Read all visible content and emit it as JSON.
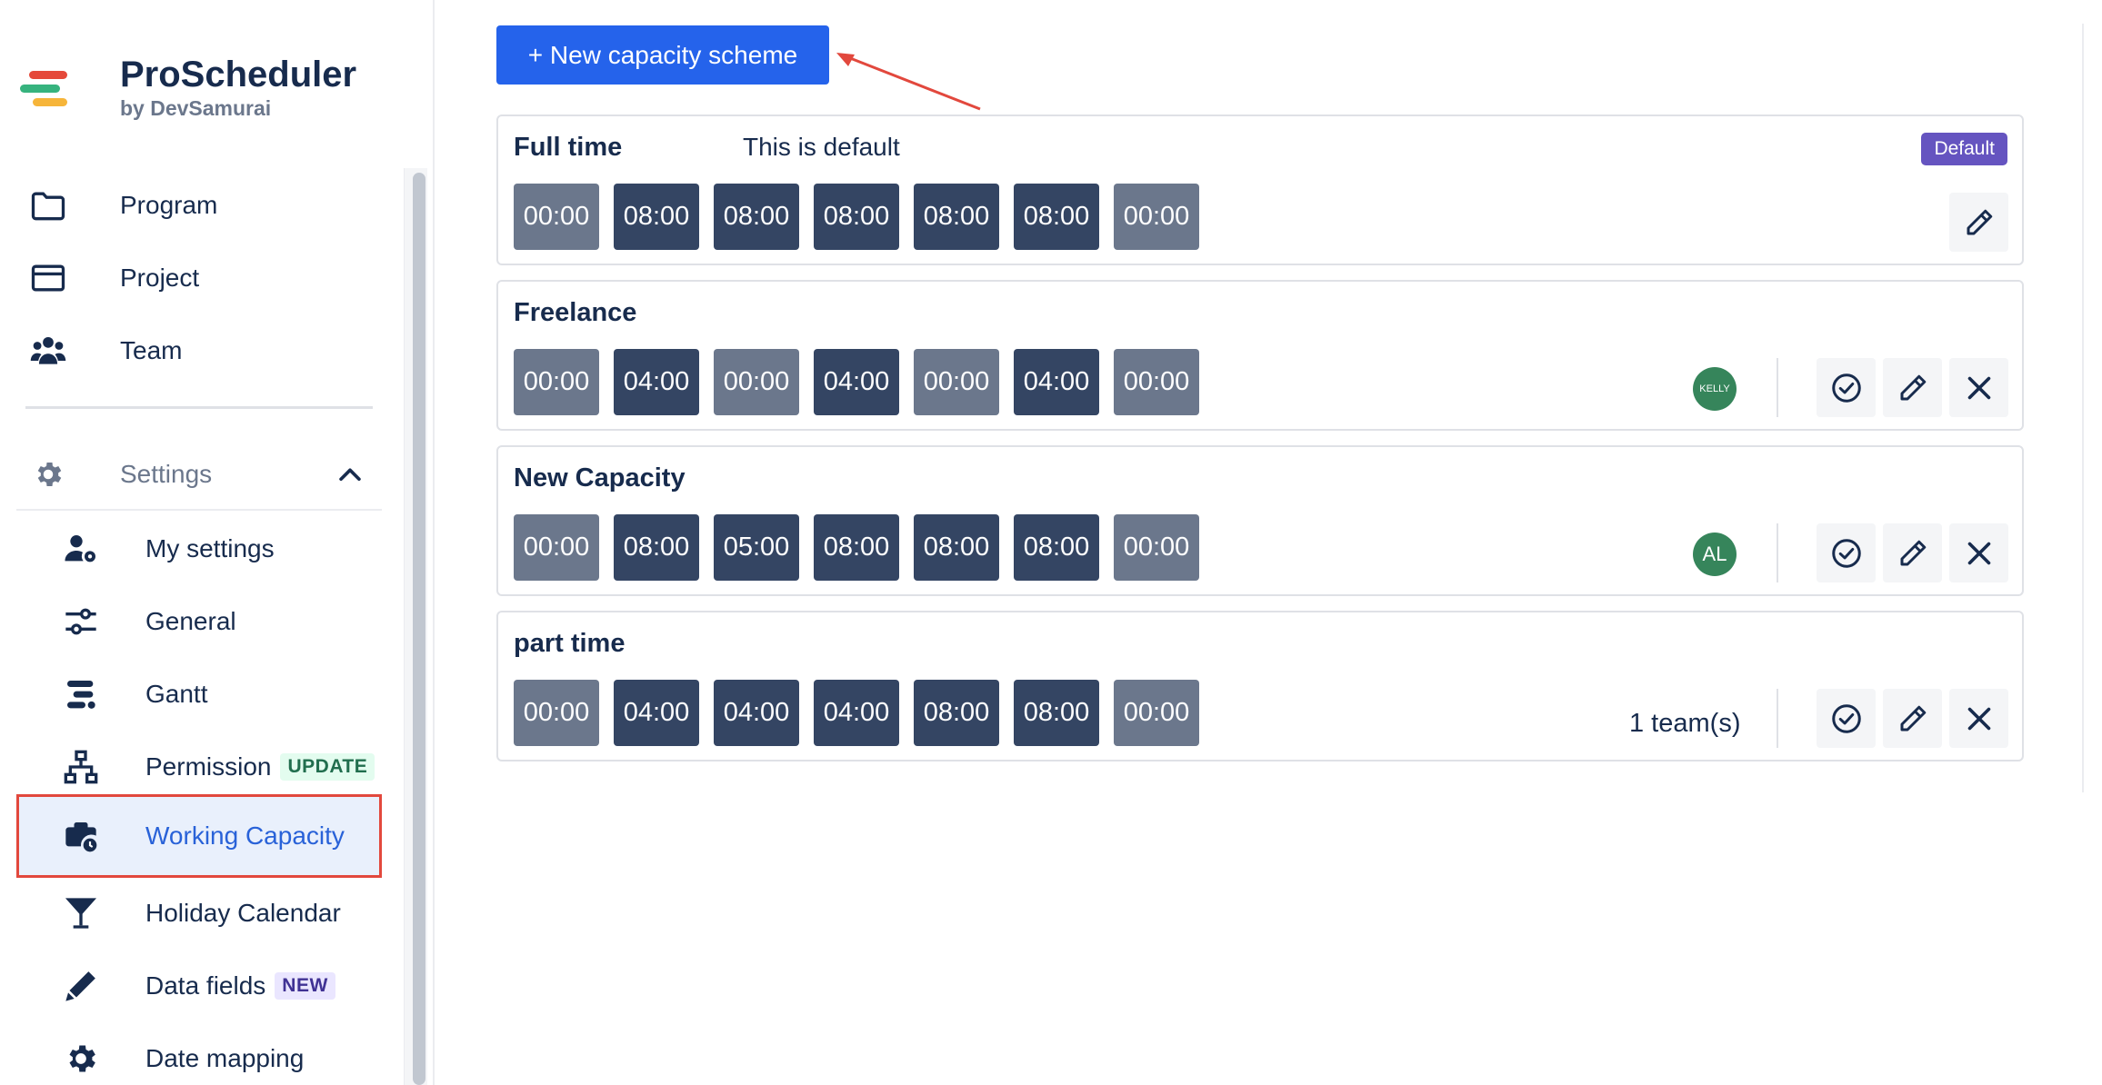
{
  "brand": {
    "title": "ProScheduler",
    "subtitle": "by DevSamurai"
  },
  "nav": {
    "program": "Program",
    "project": "Project",
    "team": "Team",
    "settings": "Settings"
  },
  "settings_items": {
    "my_settings": "My settings",
    "general": "General",
    "gantt": "Gantt",
    "permission": "Permission",
    "permission_tag": "UPDATE",
    "working_capacity": "Working Capacity",
    "holiday_calendar": "Holiday Calendar",
    "data_fields": "Data fields",
    "data_fields_tag": "NEW",
    "date_mapping": "Date mapping"
  },
  "toolbar": {
    "new_scheme_label": "+ New capacity scheme"
  },
  "schemes": [
    {
      "name": "Full time",
      "description": "This is default",
      "badge": "Default",
      "hours": [
        "00:00",
        "08:00",
        "08:00",
        "08:00",
        "08:00",
        "08:00",
        "00:00"
      ]
    },
    {
      "name": "Freelance",
      "avatar": "KELLY",
      "hours": [
        "00:00",
        "04:00",
        "00:00",
        "04:00",
        "00:00",
        "04:00",
        "00:00"
      ]
    },
    {
      "name": "New Capacity",
      "avatar": "AL",
      "hours": [
        "00:00",
        "08:00",
        "05:00",
        "08:00",
        "08:00",
        "08:00",
        "00:00"
      ]
    },
    {
      "name": "part time",
      "teams": "1 team(s)",
      "hours": [
        "00:00",
        "04:00",
        "04:00",
        "04:00",
        "08:00",
        "08:00",
        "00:00"
      ]
    }
  ],
  "colors": {
    "primary": "#2563eb",
    "active_bg": "#e9f0fc",
    "active_border": "#e2483d",
    "default_badge": "#6554c0",
    "chip_dark": "#344563",
    "chip_light": "#6b778c",
    "avatar": "#36855b"
  }
}
